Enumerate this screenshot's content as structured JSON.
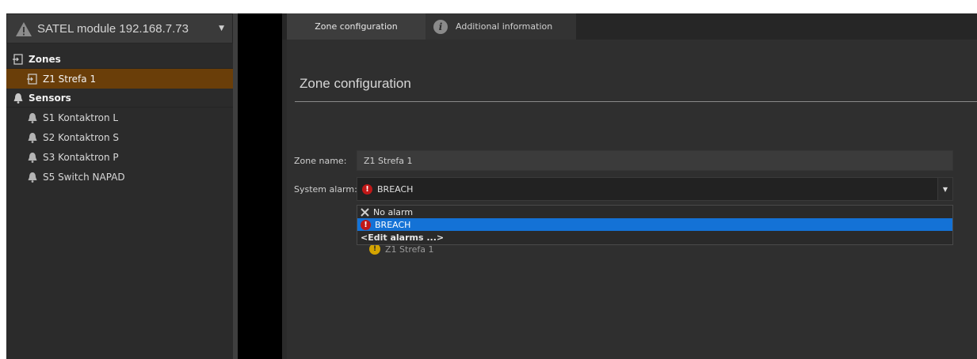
{
  "device": {
    "title": "SATEL module 192.168.7.73"
  },
  "tree": {
    "zones_header": "Zones",
    "zones": [
      {
        "label": "Z1 Strefa 1",
        "selected": true
      }
    ],
    "sensors_header": "Sensors",
    "sensors": [
      {
        "label": "S1 Kontaktron L"
      },
      {
        "label": "S2 Kontaktron S"
      },
      {
        "label": "S3 Kontaktron P"
      },
      {
        "label": "S5 Switch NAPAD"
      }
    ]
  },
  "tabs": [
    {
      "label": "Zone configuration",
      "active": true
    },
    {
      "label": "Additional information",
      "active": false
    }
  ],
  "section": {
    "title": "Zone configuration"
  },
  "form": {
    "zone_name_label": "Zone name:",
    "zone_name_value": "Z1 Strefa 1",
    "system_alarm_label": "System alarm:",
    "system_alarm_value": "BREACH"
  },
  "dropdown": {
    "options": [
      {
        "label": "No alarm",
        "icon": "x-icon"
      },
      {
        "label": "BREACH",
        "icon": "alarm-red-icon",
        "selected": true
      },
      {
        "label": "<Edit alarms ...>",
        "icon": ""
      }
    ]
  },
  "ghost": {
    "label": "Z1 Strefa 1"
  },
  "colors": {
    "selected_tree": "#6a3e09",
    "dropdown_selected": "#1472d6",
    "alarm_red": "#c01818",
    "warning_gray": "#8a8a8a"
  }
}
